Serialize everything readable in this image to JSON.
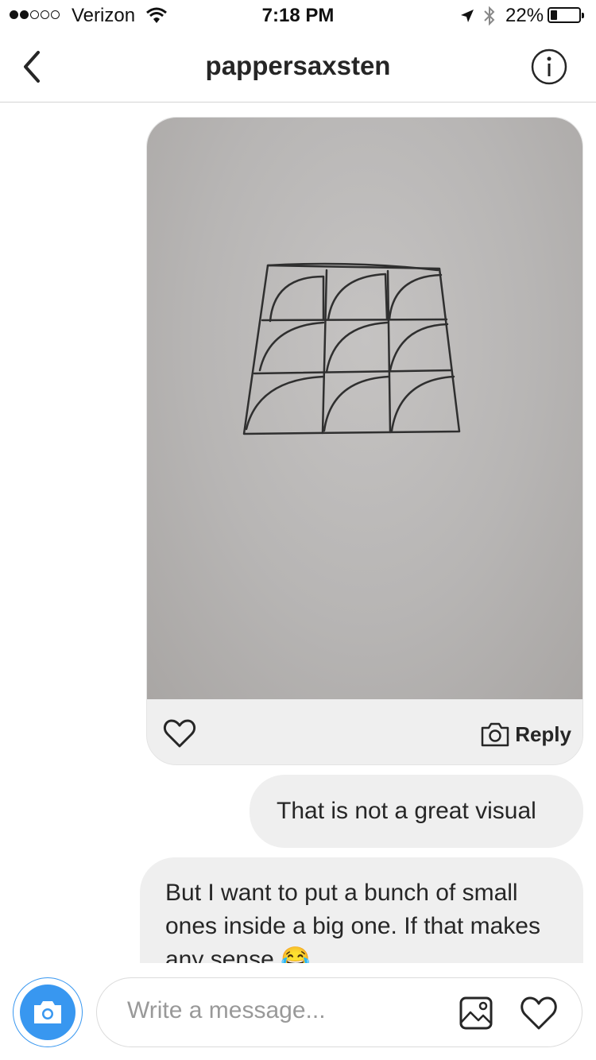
{
  "status_bar": {
    "carrier": "Verizon",
    "time": "7:18 PM",
    "battery_percent": "22%",
    "signal_bars": 2
  },
  "nav": {
    "title": "pappersaxsten"
  },
  "photo_message": {
    "reply_label": "Reply"
  },
  "messages": [
    {
      "text": "That is not a great visual"
    },
    {
      "text": "But I want to put a bunch of small ones inside a big one. If that makes any sense 😂"
    }
  ],
  "composer": {
    "placeholder": "Write a message..."
  },
  "colors": {
    "accent": "#3897f0",
    "bubble": "#efefef",
    "text": "#262626"
  }
}
